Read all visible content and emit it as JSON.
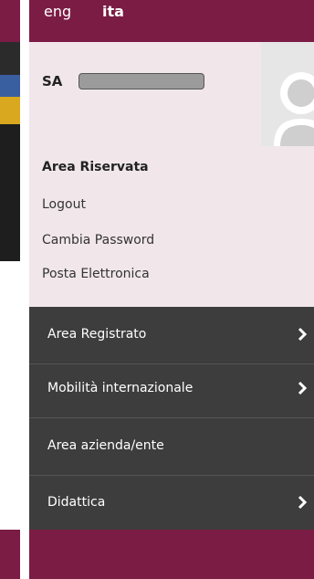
{
  "languages": {
    "eng": "eng",
    "ita": "ita"
  },
  "user": {
    "name_visible": "SA"
  },
  "reserved_area": {
    "title": "Area Riservata",
    "links": [
      "Logout",
      "Cambia Password",
      "Posta Elettronica"
    ]
  },
  "menu": {
    "items": [
      {
        "label": "Area Registrato",
        "has_submenu": true
      },
      {
        "label": "Mobilità internazionale",
        "has_submenu": true
      },
      {
        "label": "Area azienda/ente",
        "has_submenu": false
      },
      {
        "label": "Didattica",
        "has_submenu": true
      }
    ]
  },
  "colors": {
    "brand": "#7b1c44",
    "profile_bg": "#f1e7eb",
    "menu_bg": "#3d3d3d",
    "menu_text": "#ffffff"
  }
}
